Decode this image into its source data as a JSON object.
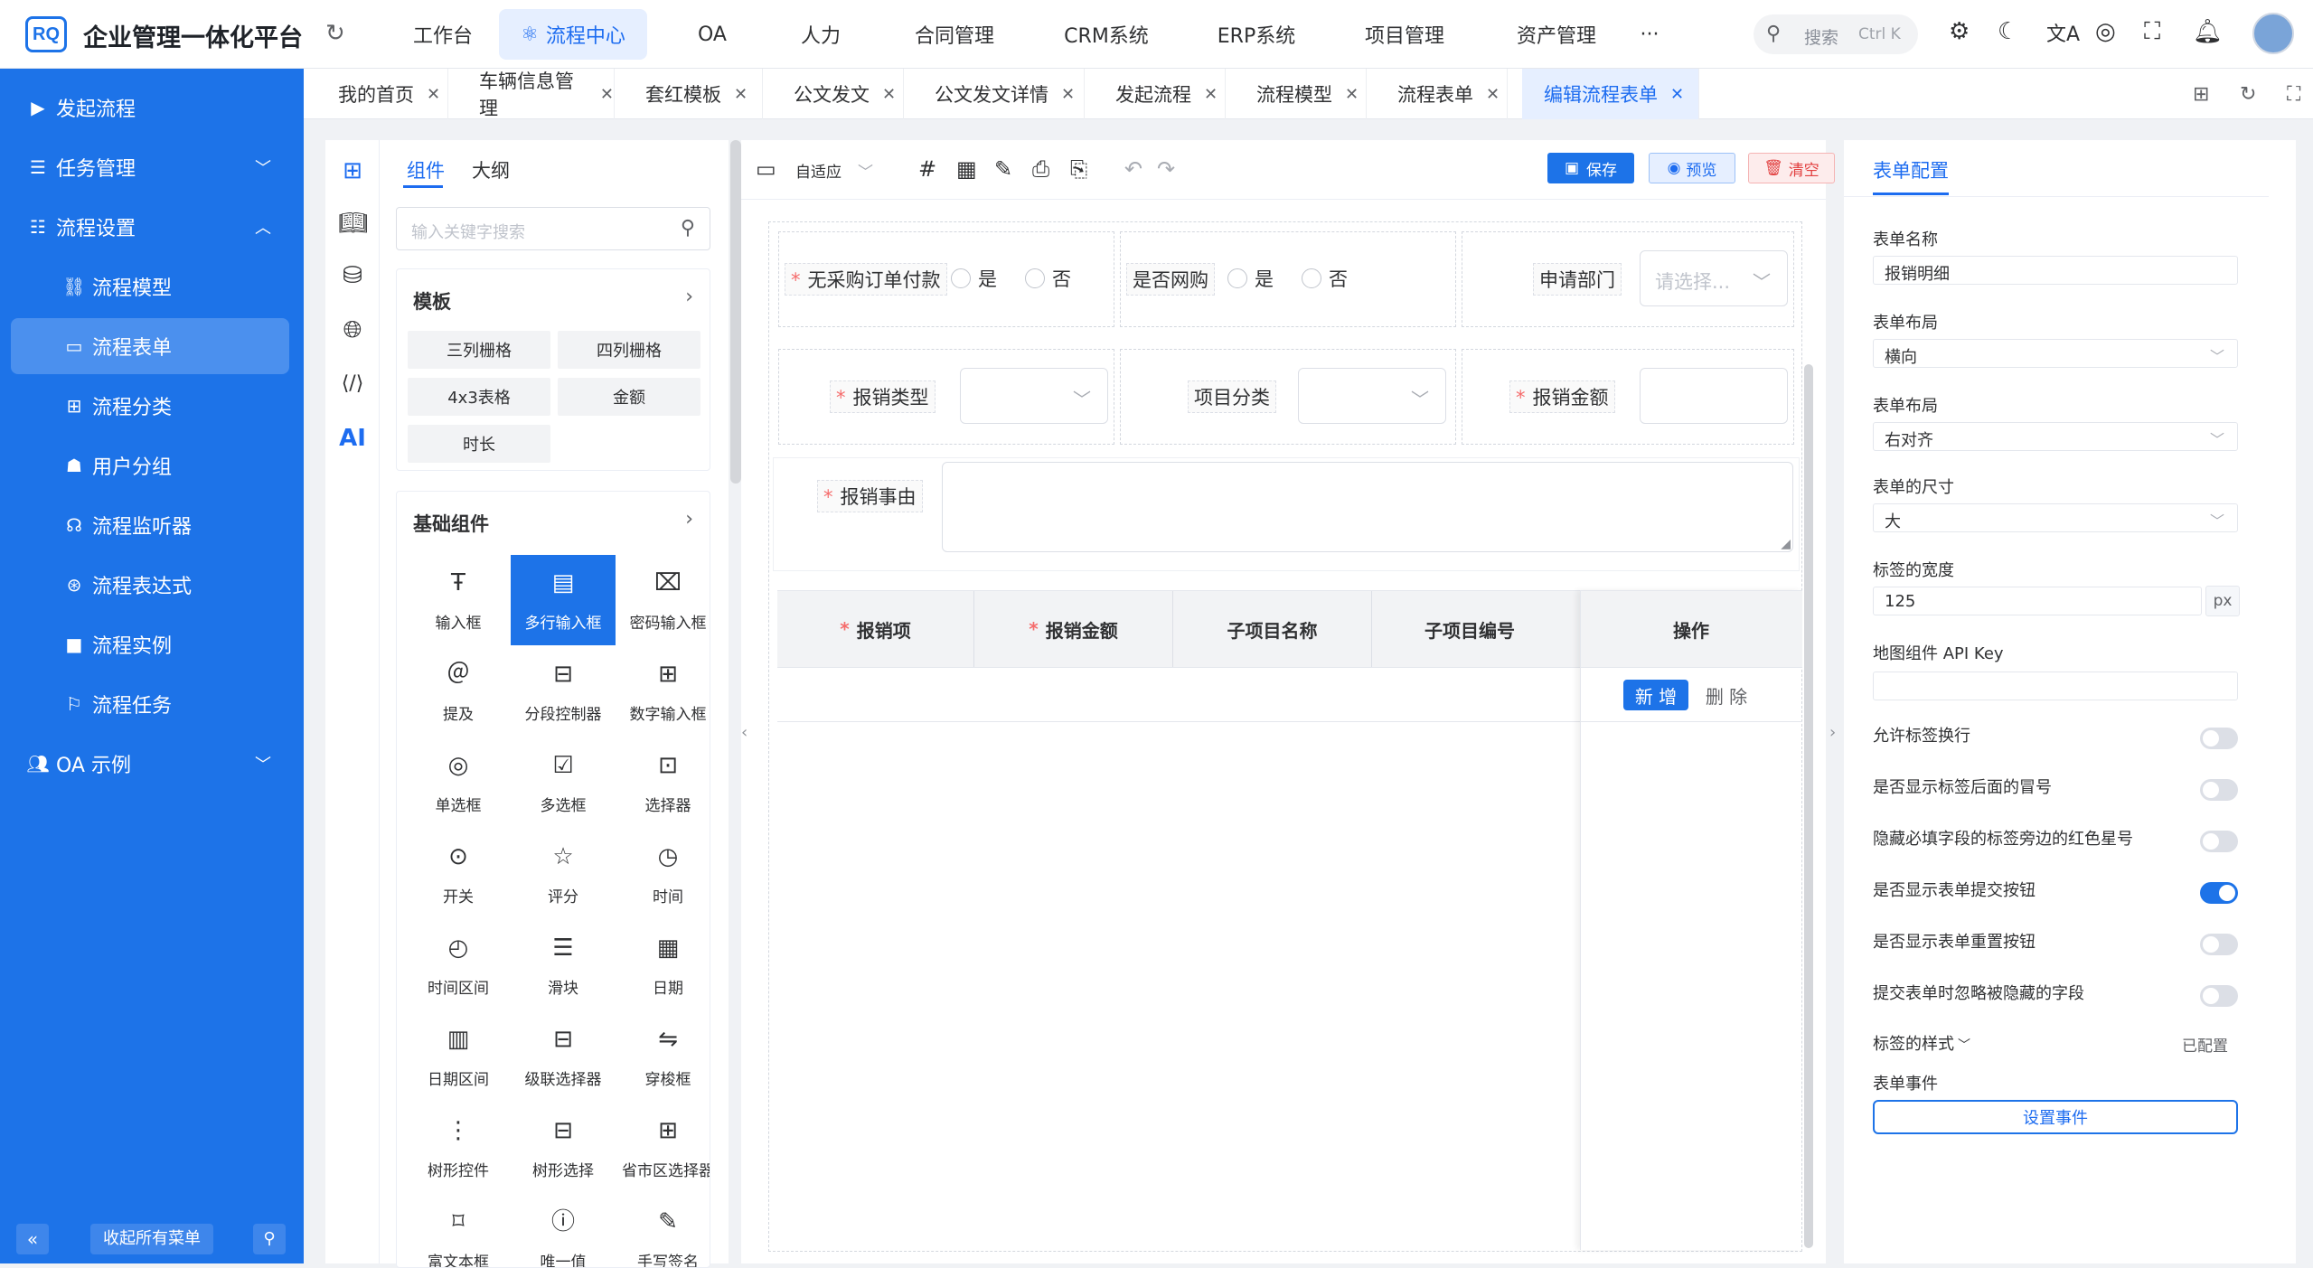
{
  "header": {
    "logo": "RQ",
    "app_title": "企业管理一体化平台",
    "nav": [
      "工作台",
      "流程中心",
      "OA",
      "人力",
      "合同管理",
      "CRM系统",
      "ERP系统",
      "项目管理",
      "资产管理",
      "···"
    ],
    "active_nav": "流程中心",
    "search_label": "搜索",
    "search_shortcut": "Ctrl K",
    "accent_color": "#1d73e8"
  },
  "sidebar": {
    "items": [
      {
        "label": "发起流程",
        "icon": "play-icon"
      },
      {
        "label": "任务管理",
        "icon": "task-icon"
      },
      {
        "label": "流程设置",
        "icon": "list-icon"
      },
      {
        "label": "流程模型",
        "icon": "model-icon"
      },
      {
        "label": "流程表单",
        "icon": "form-icon"
      },
      {
        "label": "流程分类",
        "icon": "category-icon"
      },
      {
        "label": "用户分组",
        "icon": "user-group-icon"
      },
      {
        "label": "流程监听器",
        "icon": "listener-icon"
      },
      {
        "label": "流程表达式",
        "icon": "expression-icon"
      },
      {
        "label": "流程实例",
        "icon": "instance-icon"
      },
      {
        "label": "流程任务",
        "icon": "bookmark-icon"
      },
      {
        "label": "OA 示例",
        "icon": "people-icon"
      }
    ],
    "collapse_all": "收起所有菜单"
  },
  "tabs": [
    {
      "label": "我的首页"
    },
    {
      "label": "车辆信息管理"
    },
    {
      "label": "套红模板"
    },
    {
      "label": "公文发文"
    },
    {
      "label": "公文发文详情"
    },
    {
      "label": "发起流程"
    },
    {
      "label": "流程模型"
    },
    {
      "label": "流程表单"
    },
    {
      "label": "编辑流程表单"
    }
  ],
  "left_panel": {
    "tabs": [
      "组件",
      "大纲"
    ],
    "search_placeholder": "输入关键字搜索",
    "templates_title": "模板",
    "templates": [
      "三列栅格",
      "四列栅格",
      "4x3表格",
      "金额",
      "时长"
    ],
    "basic_title": "基础组件",
    "components": [
      {
        "label": "输入框",
        "icon": "input-icon"
      },
      {
        "label": "多行输入框",
        "icon": "textarea-icon"
      },
      {
        "label": "密码输入框",
        "icon": "password-icon"
      },
      {
        "label": "提及",
        "icon": "mention-icon"
      },
      {
        "label": "分段控制器",
        "icon": "segmented-icon"
      },
      {
        "label": "数字输入框",
        "icon": "number-icon"
      },
      {
        "label": "单选框",
        "icon": "radio-icon"
      },
      {
        "label": "多选框",
        "icon": "checkbox-icon"
      },
      {
        "label": "选择器",
        "icon": "select-icon"
      },
      {
        "label": "开关",
        "icon": "switch-icon"
      },
      {
        "label": "评分",
        "icon": "star-icon"
      },
      {
        "label": "时间",
        "icon": "clock-icon"
      },
      {
        "label": "时间区间",
        "icon": "time-range-icon"
      },
      {
        "label": "滑块",
        "icon": "slider-icon"
      },
      {
        "label": "日期",
        "icon": "calendar-icon"
      },
      {
        "label": "日期区间",
        "icon": "date-range-icon"
      },
      {
        "label": "级联选择器",
        "icon": "cascader-icon"
      },
      {
        "label": "穿梭框",
        "icon": "transfer-icon"
      },
      {
        "label": "树形控件",
        "icon": "tree-icon"
      },
      {
        "label": "树形选择",
        "icon": "tree-select-icon"
      },
      {
        "label": "省市区选择器",
        "icon": "region-icon"
      },
      {
        "label": "富文本框",
        "icon": "richtext-icon"
      },
      {
        "label": "唯一值",
        "icon": "id-icon"
      },
      {
        "label": "手写签名",
        "icon": "signature-icon"
      }
    ],
    "active_component": "多行输入框",
    "ai_label": "AI"
  },
  "toolbar": {
    "adapt_label": "自适应",
    "save": "保存",
    "preview": "预览",
    "clear": "清空"
  },
  "form": {
    "row1": {
      "no_po_label": "无采购订单付款",
      "opt_yes": "是",
      "opt_no": "否",
      "online_label": "是否网购",
      "dept_label": "申请部门",
      "dept_placeholder": "请选择..."
    },
    "row2": {
      "type_label": "报销类型",
      "project_label": "项目分类",
      "amount_label": "报销金额"
    },
    "reason_label": "报销事由",
    "table": {
      "headers": [
        "报销项",
        "报销金额",
        "子项目名称",
        "子项目编号",
        "操作"
      ],
      "required": [
        true,
        true,
        false,
        false,
        false
      ],
      "add": "新 增",
      "delete": "删 除"
    }
  },
  "right_panel": {
    "tab": "表单配置",
    "form_name_label": "表单名称",
    "form_name_value": "报销明细",
    "layout_label": "表单布局",
    "layout_value": "横向",
    "align_label": "表单布局",
    "align_value": "右对齐",
    "size_label": "表单的尺寸",
    "size_value": "大",
    "label_width_label": "标签的宽度",
    "label_width_value": "125",
    "label_width_unit": "px",
    "map_key_label": "地图组件 API Key",
    "map_key_value": "",
    "switches": [
      {
        "label": "允许标签换行",
        "on": false
      },
      {
        "label": "是否显示标签后面的冒号",
        "on": false
      },
      {
        "label": "隐藏必填字段的标签旁边的红色星号",
        "on": false
      },
      {
        "label": "是否显示表单提交按钮",
        "on": true
      },
      {
        "label": "是否显示表单重置按钮",
        "on": false
      },
      {
        "label": "提交表单时忽略被隐藏的字段",
        "on": false
      }
    ],
    "label_style_label": "标签的样式",
    "label_style_value": "已配置",
    "events_label": "表单事件",
    "events_button": "设置事件"
  }
}
